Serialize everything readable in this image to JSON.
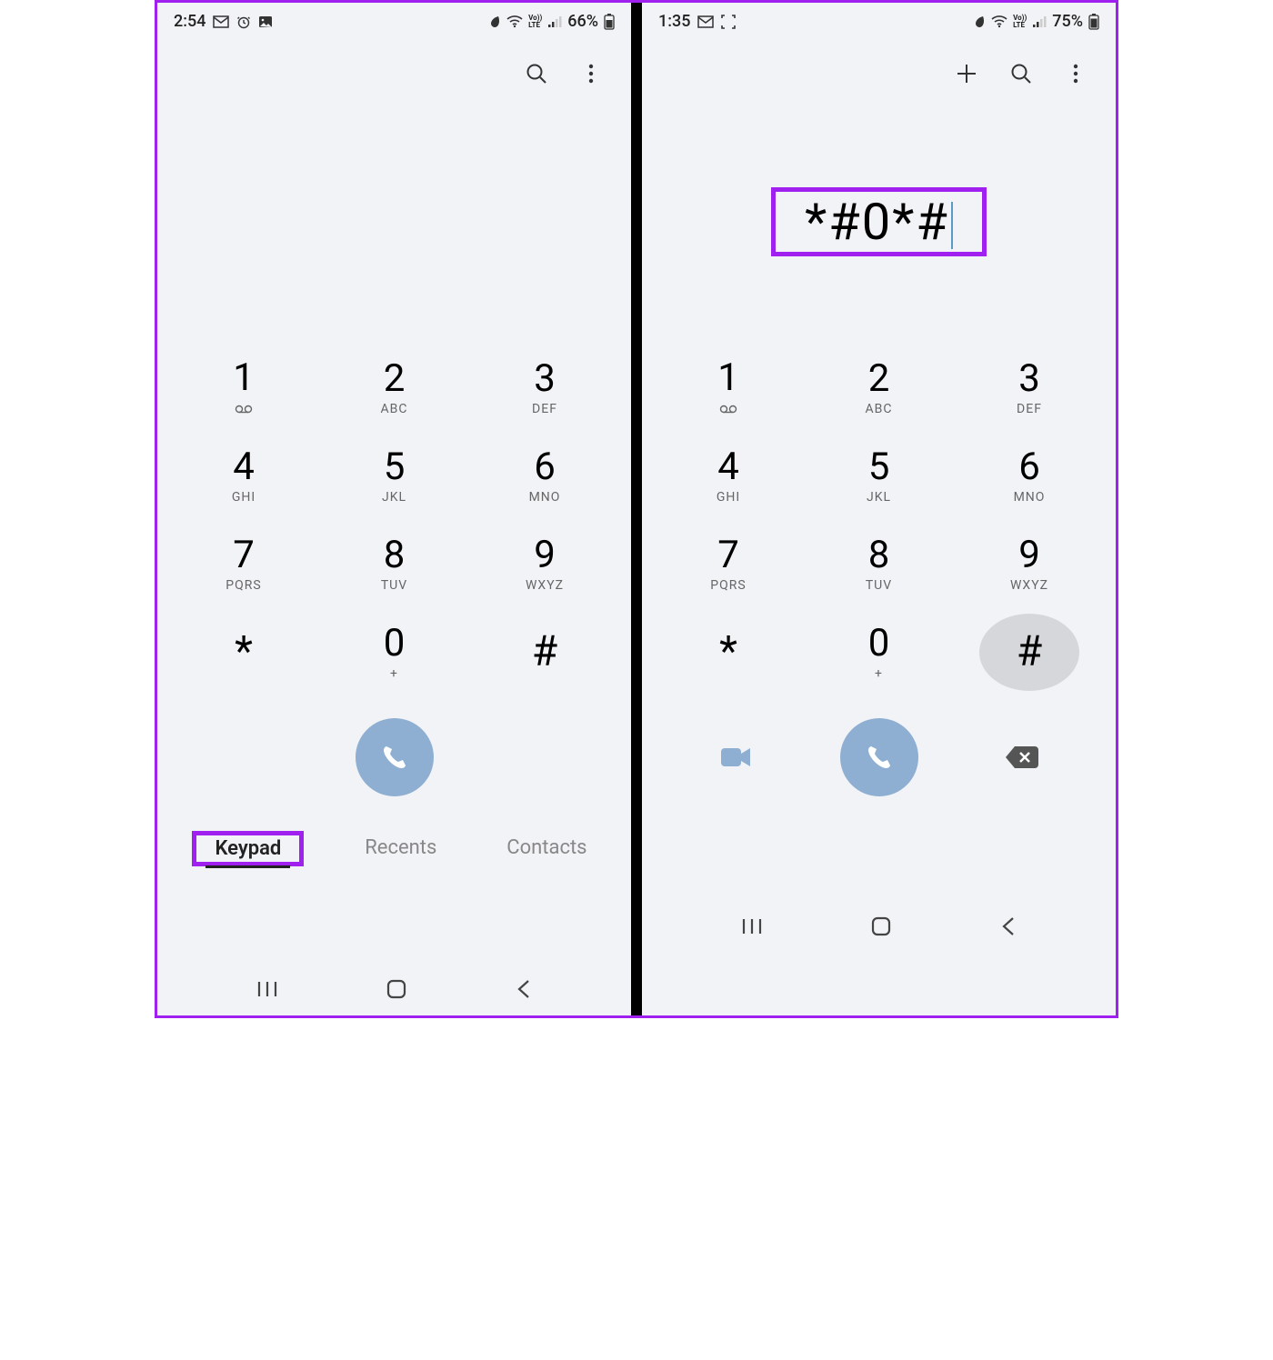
{
  "left": {
    "status": {
      "time": "2:54",
      "icons_left": [
        "gmail",
        "alarm",
        "picture"
      ],
      "icons_right": [
        "leaf",
        "wifi",
        "volte",
        "signal"
      ],
      "battery": "66%"
    },
    "top_actions": {
      "search": true,
      "more": true,
      "add": false
    },
    "dial_value": "",
    "keypad": [
      [
        {
          "d": "1",
          "s": "vm"
        },
        {
          "d": "2",
          "s": "ABC"
        },
        {
          "d": "3",
          "s": "DEF"
        }
      ],
      [
        {
          "d": "4",
          "s": "GHI"
        },
        {
          "d": "5",
          "s": "JKL"
        },
        {
          "d": "6",
          "s": "MNO"
        }
      ],
      [
        {
          "d": "7",
          "s": "PQRS"
        },
        {
          "d": "8",
          "s": "TUV"
        },
        {
          "d": "9",
          "s": "WXYZ"
        }
      ],
      [
        {
          "d": "*",
          "s": ""
        },
        {
          "d": "0",
          "s": "+"
        },
        {
          "d": "#",
          "s": ""
        }
      ]
    ],
    "action_row": {
      "video": false,
      "call": true,
      "backspace": false
    },
    "tabs": [
      {
        "label": "Keypad",
        "active": true,
        "hl": true
      },
      {
        "label": "Recents",
        "active": false
      },
      {
        "label": "Contacts",
        "active": false
      }
    ]
  },
  "right": {
    "status": {
      "time": "1:35",
      "icons_left": [
        "gmail",
        "scan"
      ],
      "icons_right": [
        "leaf",
        "wifi",
        "volte",
        "signal"
      ],
      "battery": "75%"
    },
    "top_actions": {
      "search": true,
      "more": true,
      "add": true
    },
    "dial_value": "*#0*#",
    "dial_hl": true,
    "keypad": [
      [
        {
          "d": "1",
          "s": "vm"
        },
        {
          "d": "2",
          "s": "ABC"
        },
        {
          "d": "3",
          "s": "DEF"
        }
      ],
      [
        {
          "d": "4",
          "s": "GHI"
        },
        {
          "d": "5",
          "s": "JKL"
        },
        {
          "d": "6",
          "s": "MNO"
        }
      ],
      [
        {
          "d": "7",
          "s": "PQRS"
        },
        {
          "d": "8",
          "s": "TUV"
        },
        {
          "d": "9",
          "s": "WXYZ"
        }
      ],
      [
        {
          "d": "*",
          "s": ""
        },
        {
          "d": "0",
          "s": "+"
        },
        {
          "d": "#",
          "s": "",
          "pressed": true
        }
      ]
    ],
    "action_row": {
      "video": true,
      "call": true,
      "backspace": true
    },
    "tabs": []
  },
  "highlight_color": "#a020f0"
}
